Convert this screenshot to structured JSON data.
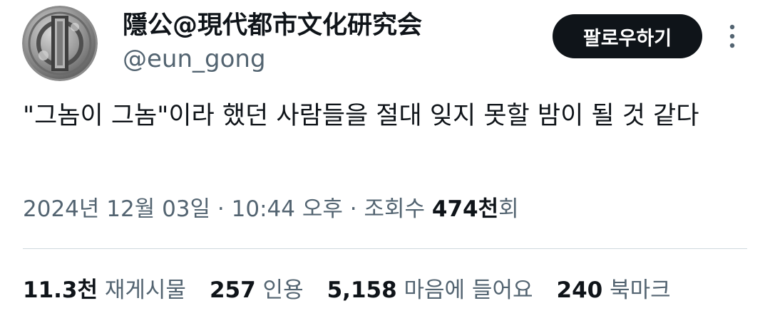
{
  "author": {
    "display_name": "隱公@現代都市文化研究会",
    "handle": "@eun_gong"
  },
  "follow_button": {
    "label": "팔로우하기"
  },
  "tweet": {
    "text": "\"그놈이 그놈\"이라 했던 사람들을 절대 잊지 못할 밤이 될 것 같다"
  },
  "meta": {
    "date": "2024년 12월 03일",
    "separator": "·",
    "time": "10:44 오후",
    "views_label": "조회수",
    "views_count": "474천",
    "views_suffix": "회"
  },
  "stats": {
    "retweets": {
      "count": "11.3천",
      "label": "재게시물"
    },
    "quotes": {
      "count": "257",
      "label": "인용"
    },
    "likes": {
      "count": "5,158",
      "label": "마음에 들어요"
    },
    "bookmarks": {
      "count": "240",
      "label": "북마크"
    }
  },
  "icons": {
    "more": "more-vertical-icon",
    "avatar": "coin-avatar-image"
  },
  "colors": {
    "text_primary": "#0f1419",
    "text_secondary": "#536471",
    "button_bg": "#0f1419",
    "button_text": "#ffffff",
    "divider": "#cfd9de"
  }
}
